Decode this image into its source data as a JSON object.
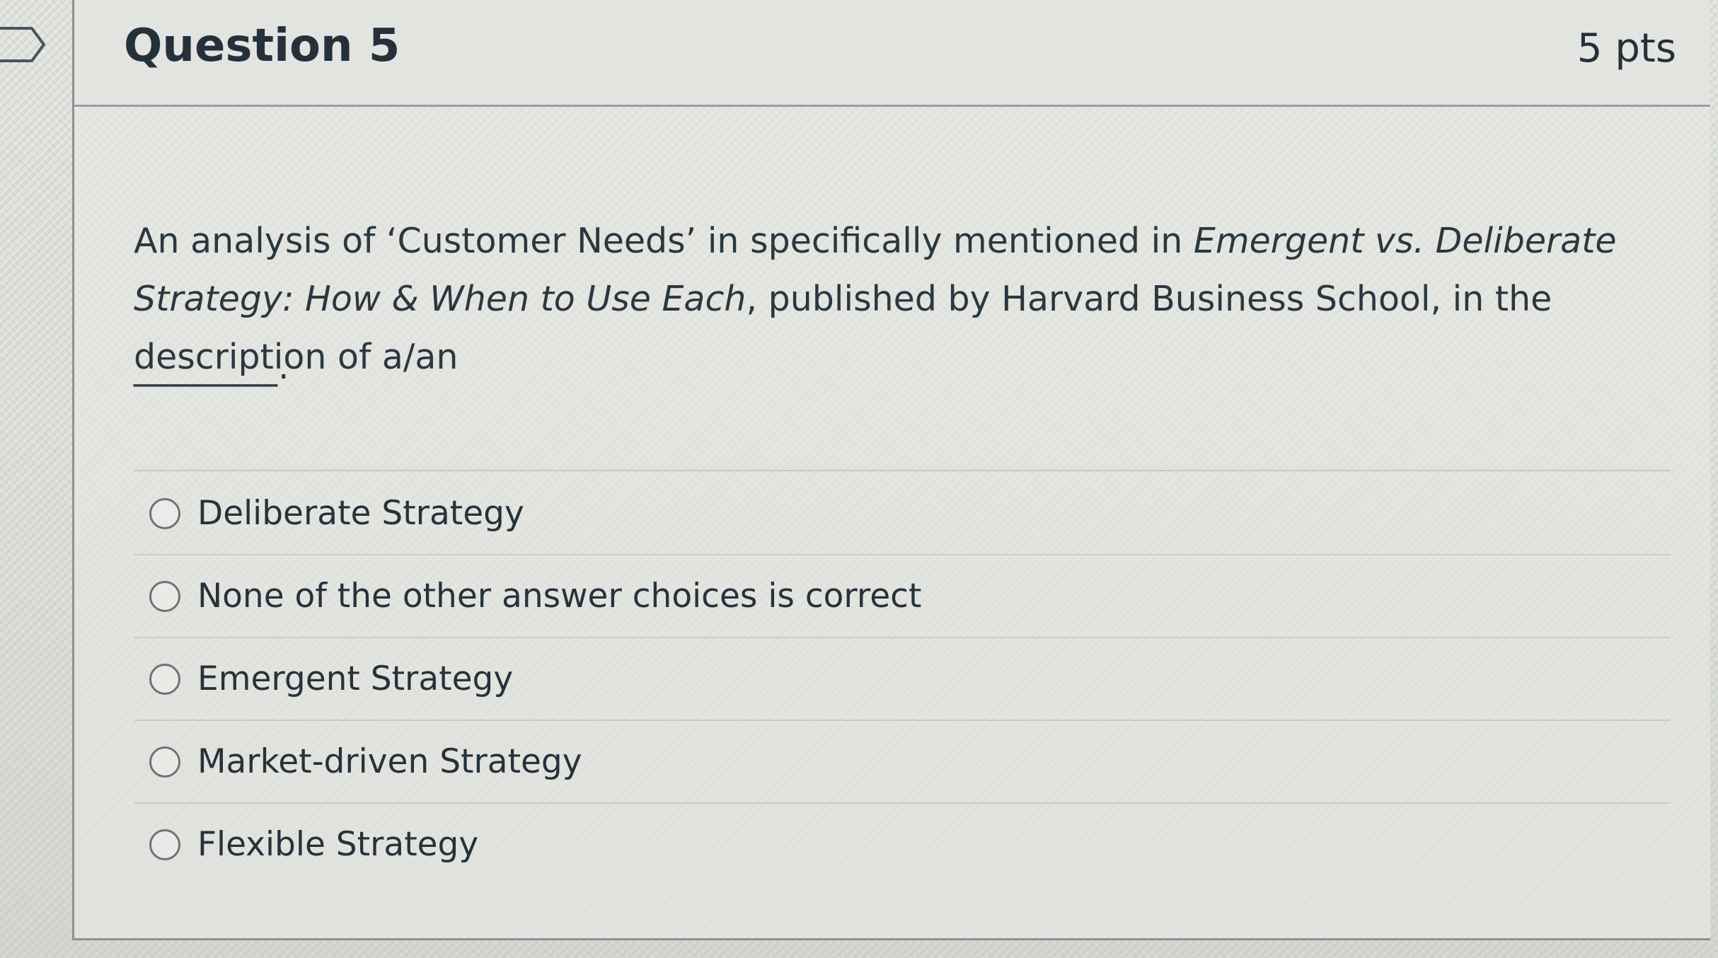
{
  "question": {
    "title": "Question 5",
    "points": "5 pts",
    "text_part1": "An analysis of ‘Customer Needs’ in specifically mentioned in ",
    "text_italic": "Emergent vs. Deliberate Strategy: How & When to Use Each",
    "text_part2": ", published by Harvard Business School, in the description of a/an",
    "blank": "________."
  },
  "answers": [
    {
      "label": "Deliberate Strategy",
      "selected": false
    },
    {
      "label": "None of the other answer choices is correct",
      "selected": false
    },
    {
      "label": "Emergent Strategy",
      "selected": false
    },
    {
      "label": "Market-driven Strategy",
      "selected": false
    },
    {
      "label": "Flexible Strategy",
      "selected": false
    }
  ],
  "colors": {
    "text": "#2d3b45",
    "radio_border": "#6d7378",
    "card_border": "#8d9197"
  },
  "icons": {
    "bookmark": "bookmark-icon",
    "radio": "radio-unselected-icon"
  }
}
